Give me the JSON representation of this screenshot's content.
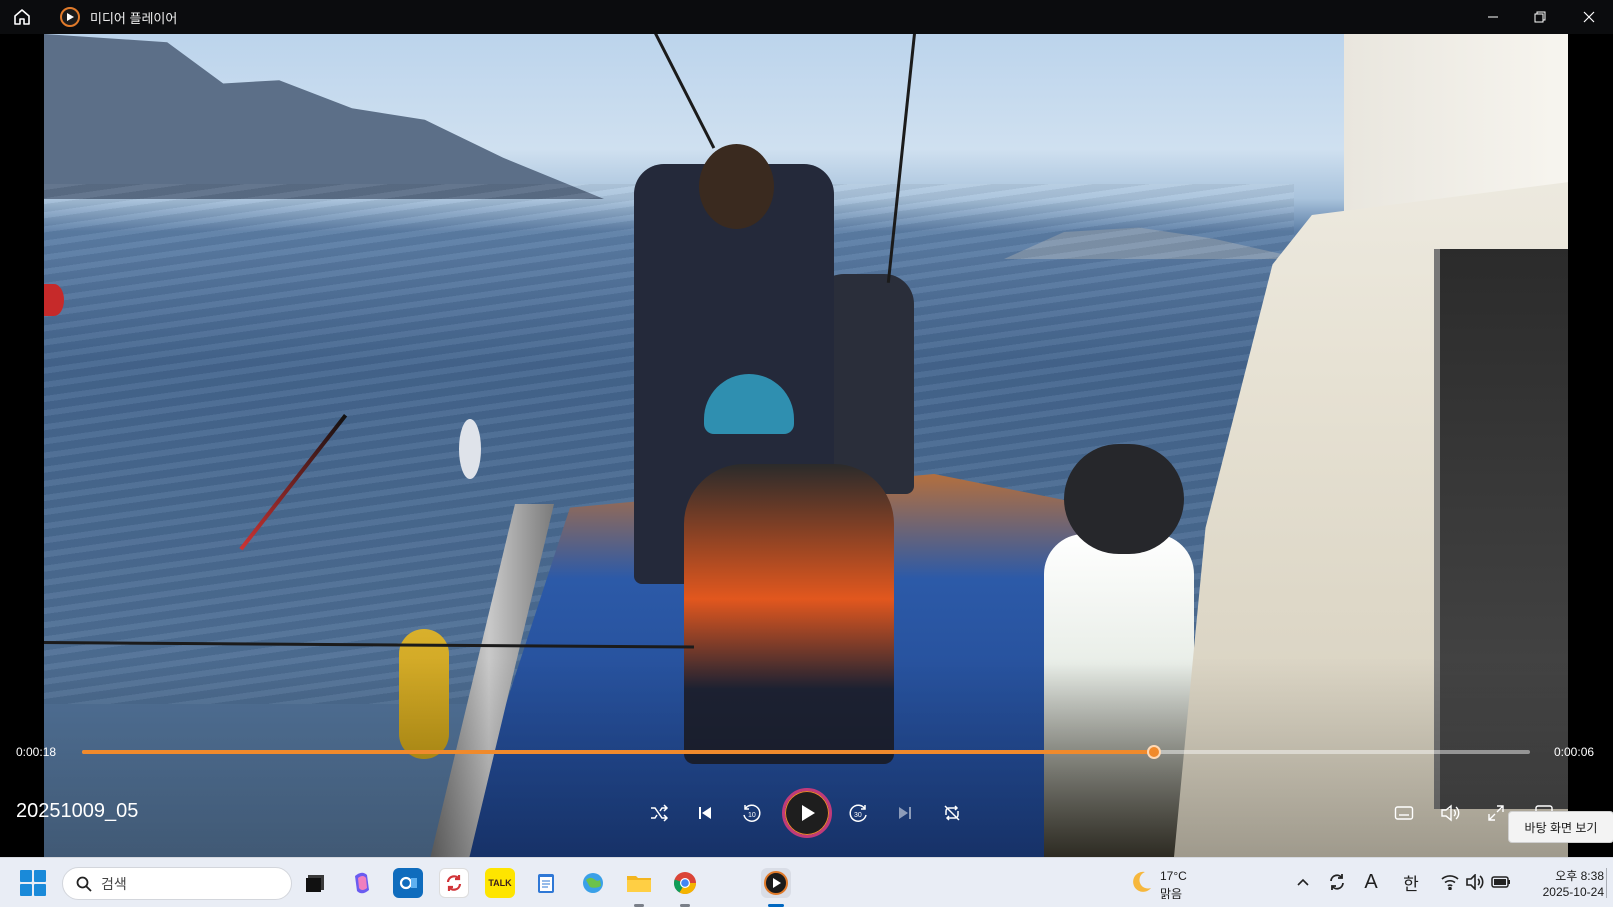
{
  "window": {
    "app_title": "미디어 플레이어",
    "icons": {
      "home": "home-icon",
      "app": "media-player-icon",
      "minimize": "minimize-icon",
      "restore": "restore-icon",
      "close": "close-icon"
    }
  },
  "player": {
    "media_title": "20251009_05",
    "elapsed_time": "0:00:18",
    "remaining_time": "0:00:06",
    "progress_fraction": 0.74,
    "accent_color": "#f08a2c",
    "tooltip": "바탕 화면 보기",
    "controls": [
      "shuffle-icon",
      "previous-icon",
      "rewind-10-icon",
      "play-icon",
      "forward-30-icon",
      "next-icon",
      "repeat-off-icon",
      "subtitles-icon",
      "volume-icon",
      "fullscreen-icon",
      "miniplayer-icon"
    ]
  },
  "taskbar": {
    "search_placeholder": "검색",
    "apps": [
      "task-view-icon",
      "copilot-icon",
      "outlook-icon",
      "sync-app-icon",
      "kakaotalk-icon",
      "notepad-icon",
      "globe-app-icon",
      "file-explorer-icon",
      "chrome-icon",
      "media-player-icon"
    ],
    "kakaotalk_badge": "TALK",
    "weather": {
      "temperature": "17°C",
      "condition": "맑음",
      "icon": "moon-icon"
    },
    "tray": {
      "ime_mode_a": "A",
      "ime_mode_korean": "한"
    },
    "clock": {
      "time": "오후 8:38",
      "date": "2025-10-24"
    }
  }
}
